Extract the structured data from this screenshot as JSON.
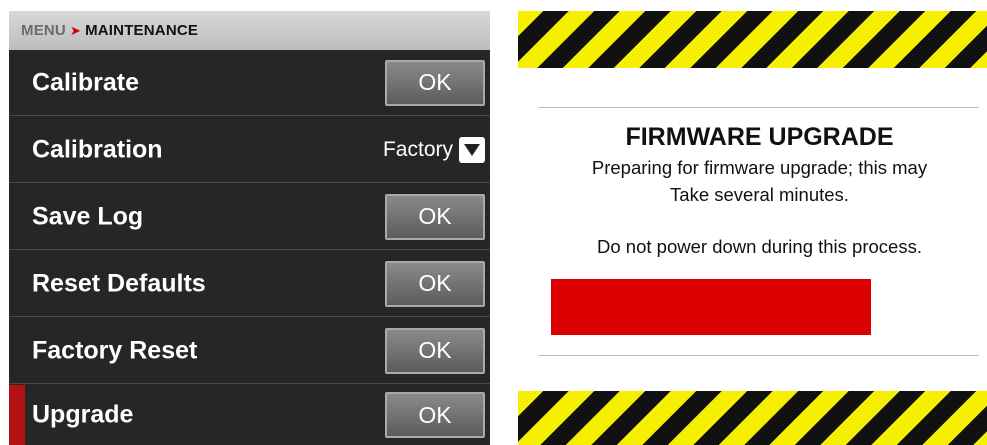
{
  "breadcrumb": {
    "root": "MENU",
    "separator": "➤",
    "current": "MAINTENANCE"
  },
  "menu": {
    "rows": [
      {
        "label": "Calibrate",
        "control": "button",
        "button_label": "OK"
      },
      {
        "label": "Calibration",
        "control": "select",
        "selected_value": "Factory",
        "icon": "chevron-down-icon"
      },
      {
        "label": "Save Log",
        "control": "button",
        "button_label": "OK"
      },
      {
        "label": "Reset Defaults",
        "control": "button",
        "button_label": "OK"
      },
      {
        "label": "Factory Reset",
        "control": "button",
        "button_label": "OK"
      },
      {
        "label": "Upgrade",
        "control": "button",
        "button_label": "OK",
        "selected": true
      }
    ]
  },
  "firmware_dialog": {
    "title": "FIRMWARE UPGRADE",
    "message_line1": "Preparing for firmware upgrade; this may",
    "message_line2": "Take several minutes.",
    "warning": "Do not power down during this process.",
    "progress_fraction": 0.8
  },
  "colors": {
    "accent_red": "#dc0000",
    "selection_red": "#b31212",
    "hazard_yellow": "#f6f000",
    "hazard_black": "#111111",
    "menu_background": "#262626"
  }
}
